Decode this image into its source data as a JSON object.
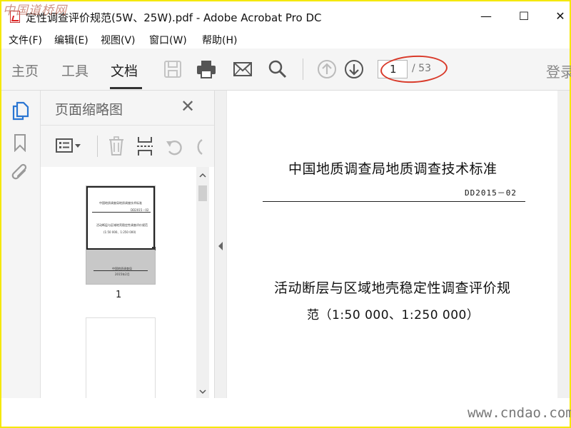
{
  "watermark_top": "中国道桥网",
  "window": {
    "title": "定性调查评价规范(5W、25W).pdf - Adobe Acrobat Pro DC",
    "minimize": "—",
    "maximize": "☐",
    "close": "✕"
  },
  "menu": {
    "items": [
      {
        "label": "文件(F)"
      },
      {
        "label": "编辑(E)"
      },
      {
        "label": "视图(V)"
      },
      {
        "label": "窗口(W)"
      },
      {
        "label": "帮助(H)"
      }
    ]
  },
  "toolbar": {
    "tabs": [
      {
        "label": "主页",
        "active": false
      },
      {
        "label": "工具",
        "active": false
      },
      {
        "label": "文档",
        "active": true
      }
    ],
    "icons": [
      "save-icon",
      "print-icon",
      "email-icon",
      "search-icon",
      "page-up-icon",
      "page-down-icon"
    ],
    "page_current": "1",
    "page_total": "/ 53",
    "signin": "登录"
  },
  "left_rail": {
    "icons": [
      "page-thumbnails-icon",
      "bookmarks-icon",
      "attachments-icon"
    ],
    "accent": "#2a76d2"
  },
  "panel": {
    "title": "页面缩略图",
    "close": "✕",
    "toolbar_icons": [
      "thumbnail-options-icon",
      "delete-icon",
      "insert-page-icon",
      "undo-icon",
      "redo-icon"
    ],
    "thumbnails": [
      {
        "number": "1",
        "heading": "中国地质调查局地质调查技术标准",
        "code": "DD2015－02",
        "title": "活动断层与区域地壳稳定性调查评价规范",
        "scale": "(1:50 000、1:250 000)",
        "publisher": "中国地质调查局",
        "date": "2015年2月"
      },
      {
        "number": ""
      }
    ]
  },
  "document": {
    "heading": "中国地质调查局地质调查技术标准",
    "code": "DD2015－02",
    "title_line1": "活动断层与区域地壳稳定性调查评价规",
    "title_line2": "范（1:50 000、1:250 000）"
  },
  "annotation": {
    "color": "#d93a2a"
  },
  "watermark_bottom": "www.cndao.com",
  "colors": {
    "frame": "#f5e800",
    "toolbar_bg": "#f5f5f5"
  }
}
